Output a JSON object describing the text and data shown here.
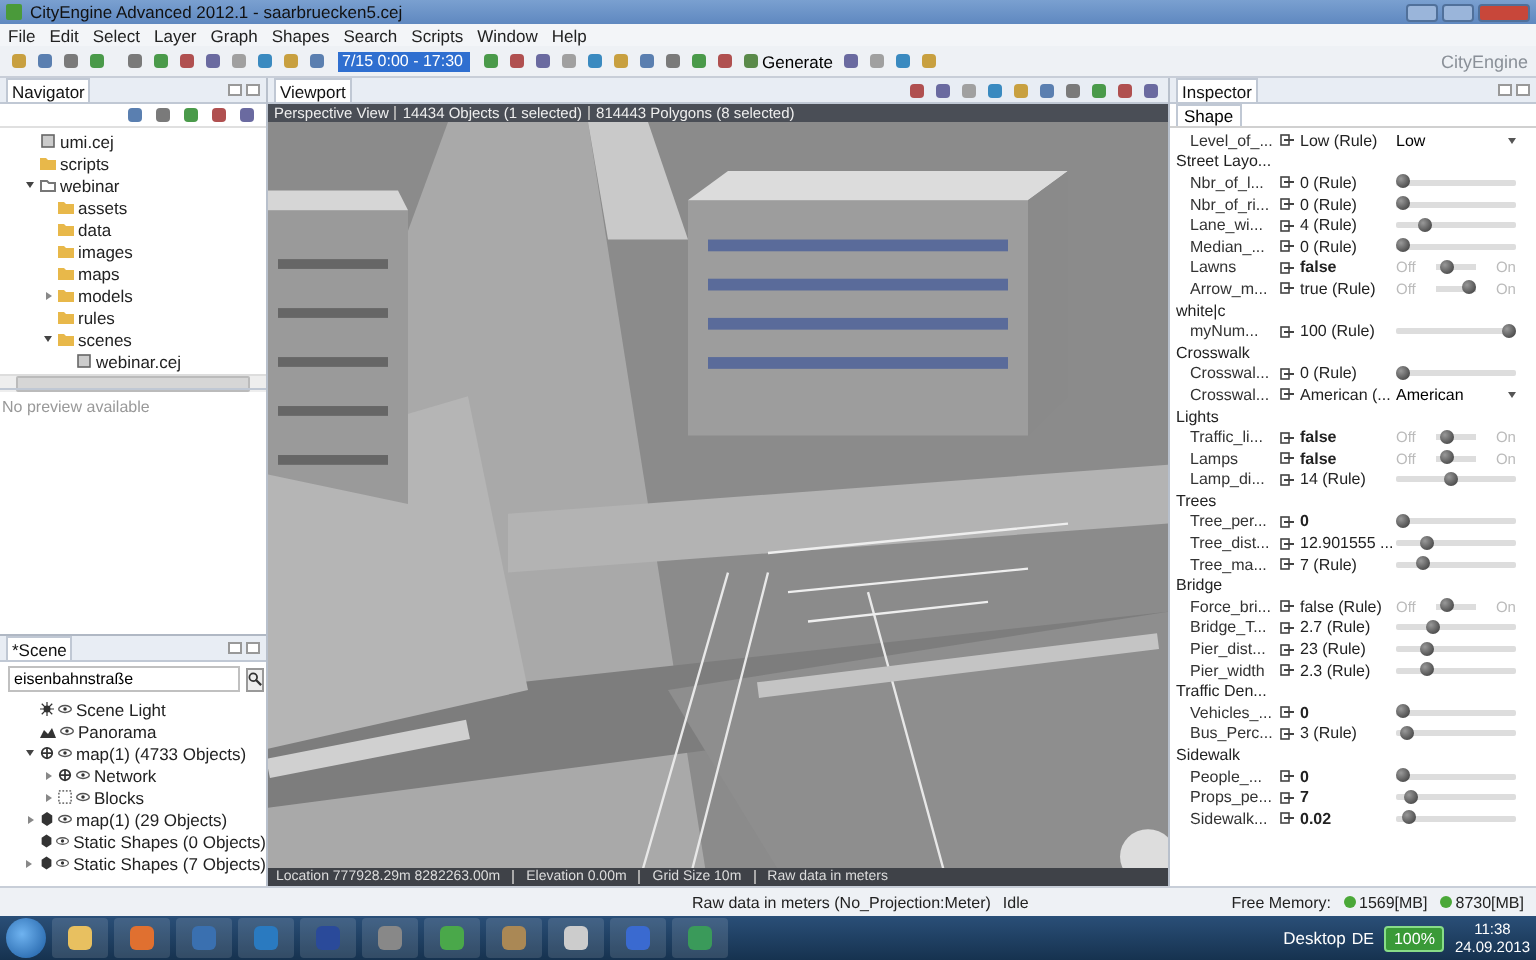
{
  "window": {
    "title": "CityEngine Advanced 2012.1 - saarbruecken5.cej"
  },
  "menu": [
    "File",
    "Edit",
    "Select",
    "Layer",
    "Graph",
    "Shapes",
    "Search",
    "Scripts",
    "Window",
    "Help"
  ],
  "toolbar": {
    "time_field": "7/15 0:00 - 17:30",
    "generate": "Generate",
    "brand": "CityEngine"
  },
  "navigator": {
    "title": "Navigator",
    "preview": "No preview available",
    "tree": [
      {
        "label": "umi.cej",
        "kind": "file"
      },
      {
        "label": "scripts",
        "kind": "folder"
      },
      {
        "label": "webinar",
        "kind": "project",
        "expanded": true,
        "children": [
          {
            "label": "assets",
            "kind": "folder"
          },
          {
            "label": "data",
            "kind": "folder"
          },
          {
            "label": "images",
            "kind": "folder"
          },
          {
            "label": "maps",
            "kind": "folder"
          },
          {
            "label": "models",
            "kind": "folder",
            "expanded": false
          },
          {
            "label": "rules",
            "kind": "folder"
          },
          {
            "label": "scenes",
            "kind": "folder",
            "expanded": true,
            "children": [
              {
                "label": "webinar.cej",
                "kind": "file"
              }
            ]
          }
        ]
      }
    ]
  },
  "scene": {
    "title": "*Scene",
    "search": "eisenbahnstraße",
    "tree": [
      {
        "label": "Scene Light",
        "kind": "light"
      },
      {
        "label": "Panorama",
        "kind": "panorama"
      },
      {
        "label": "map(1) (4733 Objects)",
        "kind": "network",
        "expanded": true,
        "children": [
          {
            "label": "Network",
            "kind": "network",
            "expanded": false
          },
          {
            "label": "Blocks",
            "kind": "blocks",
            "expanded": false
          }
        ]
      },
      {
        "label": "map(1) (29 Objects)",
        "kind": "shapes",
        "expanded": false
      },
      {
        "label": "Static Shapes (0 Objects)",
        "kind": "shapes"
      },
      {
        "label": "Static Shapes (7 Objects)",
        "kind": "shapes",
        "expanded": false
      }
    ]
  },
  "viewport": {
    "title": "Viewport",
    "info": [
      "Perspective View",
      "14434 Objects (1 selected)",
      "814443 Polygons (8 selected)"
    ],
    "footer": [
      "Location 777928.29m 8282263.00m",
      "Elevation 0.00m",
      "Grid Size 10m",
      "Raw data in meters"
    ]
  },
  "inspector": {
    "title": "Inspector",
    "tab": "Shape",
    "rows": [
      {
        "kind": "dropdown",
        "label": "Level_of_...",
        "value": "Low (Rule)",
        "user_set": false,
        "choice": "Low"
      },
      {
        "kind": "group",
        "label": "Street Layo..."
      },
      {
        "kind": "slider",
        "label": "Nbr_of_l...",
        "value": "0 (Rule)",
        "user_set": false,
        "level": 0
      },
      {
        "kind": "slider",
        "label": "Nbr_of_ri...",
        "value": "0 (Rule)",
        "user_set": false,
        "level": 0
      },
      {
        "kind": "slider",
        "label": "Lane_wi...",
        "value": "4 (Rule)",
        "user_set": false,
        "level": 0.2
      },
      {
        "kind": "slider",
        "label": "Median_...",
        "value": "0 (Rule)",
        "user_set": false,
        "level": 0
      },
      {
        "kind": "toggle",
        "label": "Lawns",
        "value": "false",
        "user_set": true,
        "checked": false,
        "off_label": "Off",
        "on_label": "On"
      },
      {
        "kind": "toggle",
        "label": "Arrow_m...",
        "value": "true (Rule)",
        "user_set": false,
        "checked": true,
        "off_label": "Off",
        "on_label": "On"
      },
      {
        "kind": "group",
        "label": "white|c"
      },
      {
        "kind": "slider",
        "label": "myNum...",
        "value": "100 (Rule)",
        "user_set": false,
        "level": 1
      },
      {
        "kind": "group",
        "label": "Crosswalk"
      },
      {
        "kind": "slider",
        "label": "Crosswal...",
        "value": "0 (Rule)",
        "user_set": false,
        "level": 0
      },
      {
        "kind": "dropdown",
        "label": "Crosswal...",
        "value": "American (...",
        "user_set": false,
        "choice": "American"
      },
      {
        "kind": "group",
        "label": "Lights"
      },
      {
        "kind": "toggle",
        "label": "Traffic_li...",
        "value": "false",
        "user_set": true,
        "checked": false,
        "off_label": "Off",
        "on_label": "On"
      },
      {
        "kind": "toggle",
        "label": "Lamps",
        "value": "false",
        "user_set": true,
        "checked": false,
        "off_label": "Off",
        "on_label": "On"
      },
      {
        "kind": "slider",
        "label": "Lamp_di...",
        "value": "14 (Rule)",
        "user_set": false,
        "level": 0.45
      },
      {
        "kind": "group",
        "label": "Trees"
      },
      {
        "kind": "slider",
        "label": "Tree_per...",
        "value": "0",
        "user_set": true,
        "level": 0
      },
      {
        "kind": "slider",
        "label": "Tree_dist...",
        "value": "12.901555 ...",
        "user_set": false,
        "level": 0.22
      },
      {
        "kind": "slider",
        "label": "Tree_ma...",
        "value": "7 (Rule)",
        "user_set": false,
        "level": 0.18
      },
      {
        "kind": "group",
        "label": "Bridge"
      },
      {
        "kind": "toggle",
        "label": "Force_bri...",
        "value": "false (Rule)",
        "user_set": false,
        "checked": false,
        "off_label": "Off",
        "on_label": "On"
      },
      {
        "kind": "slider",
        "label": "Bridge_T...",
        "value": "2.7 (Rule)",
        "user_set": false,
        "level": 0.28
      },
      {
        "kind": "slider",
        "label": "Pier_dist...",
        "value": "23 (Rule)",
        "user_set": false,
        "level": 0.22
      },
      {
        "kind": "slider",
        "label": "Pier_width",
        "value": "2.3 (Rule)",
        "user_set": false,
        "level": 0.22
      },
      {
        "kind": "group",
        "label": "Traffic Den..."
      },
      {
        "kind": "slider",
        "label": "Vehicles_...",
        "value": "0",
        "user_set": true,
        "level": 0
      },
      {
        "kind": "slider",
        "label": "Bus_Perc...",
        "value": "3 (Rule)",
        "user_set": false,
        "level": 0.03
      },
      {
        "kind": "group",
        "label": "Sidewalk"
      },
      {
        "kind": "slider",
        "label": "People_...",
        "value": "0",
        "user_set": true,
        "level": 0
      },
      {
        "kind": "slider",
        "label": "Props_pe...",
        "value": "7",
        "user_set": true,
        "level": 0.07
      },
      {
        "kind": "slider",
        "label": "Sidewalk...",
        "value": "0.02",
        "user_set": true,
        "level": 0.05
      }
    ]
  },
  "status_bar": {
    "projection": "Raw data in meters (No_Projection:Meter)",
    "state": "Idle",
    "memory_label": "Free Memory:",
    "memory": [
      "1569[MB]",
      "8730[MB]"
    ]
  },
  "taskbar": {
    "desktop": "Desktop",
    "language": "DE",
    "battery": "100%",
    "time": "11:38",
    "date": "24.09.2013"
  }
}
